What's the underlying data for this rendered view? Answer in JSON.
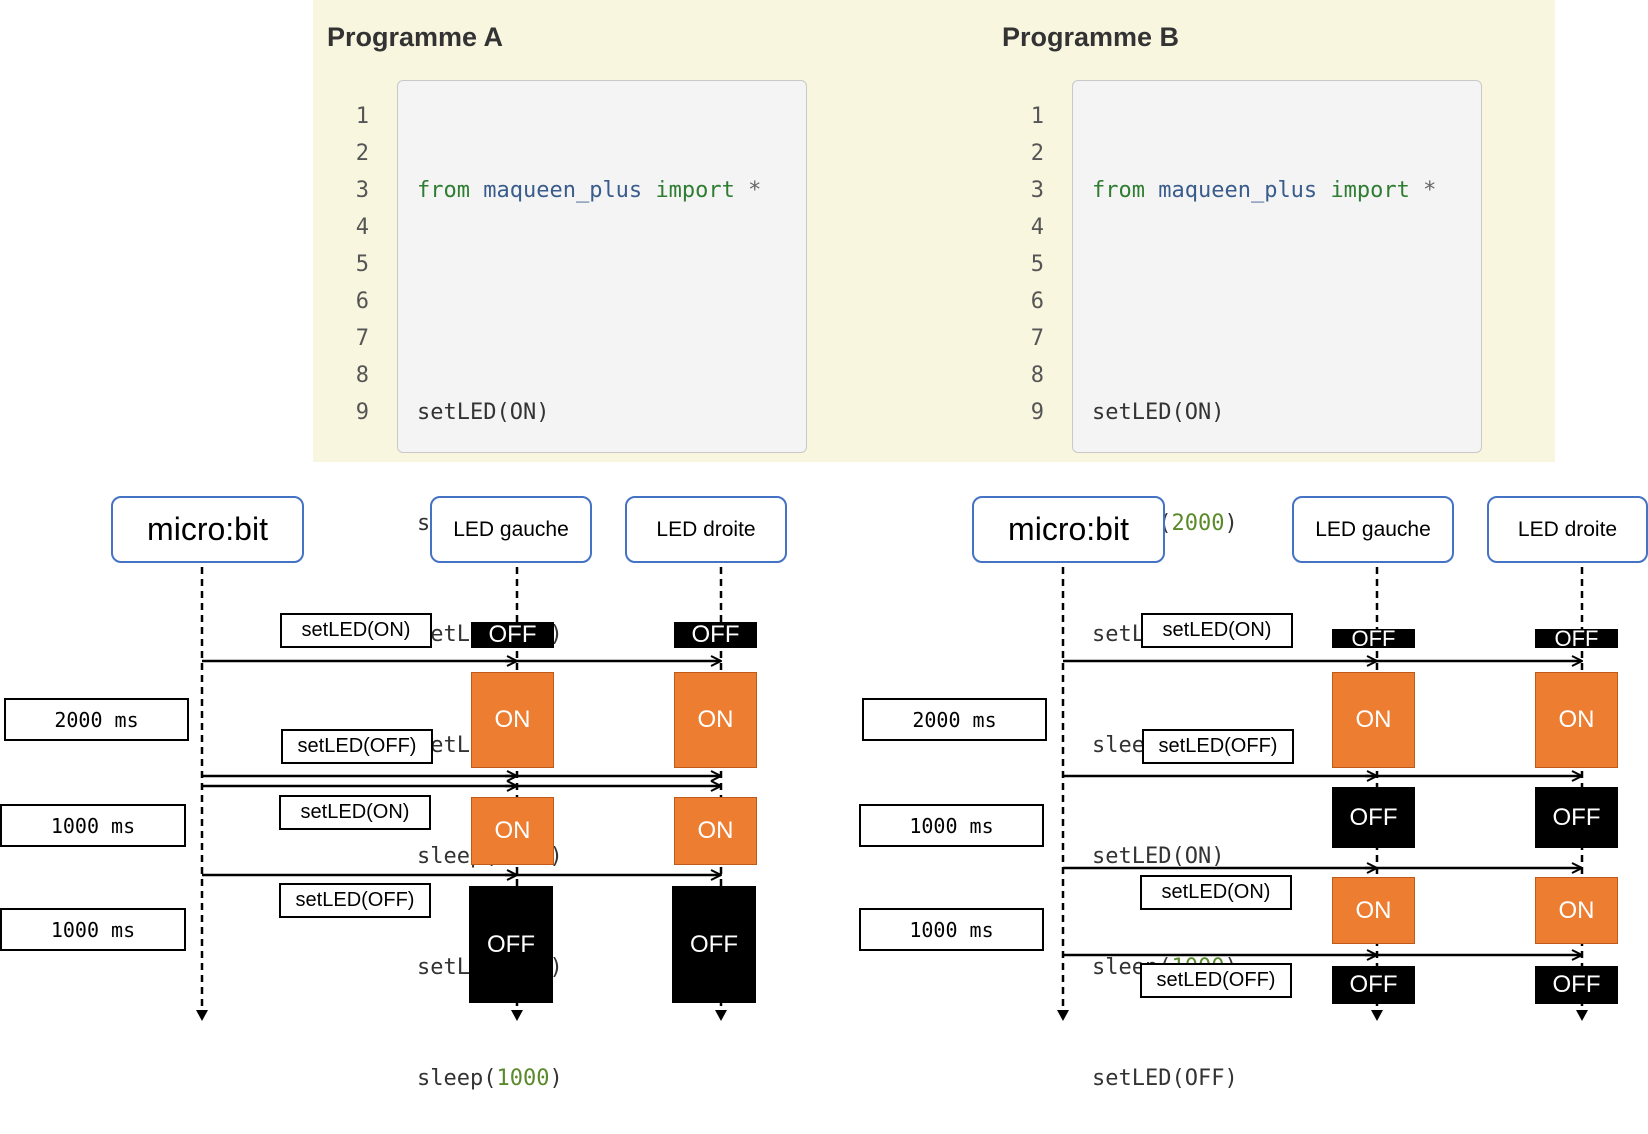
{
  "programs": {
    "a": {
      "title": "Programme A",
      "line_numbers": [
        "1",
        "2",
        "3",
        "4",
        "5",
        "6",
        "7",
        "8",
        "9"
      ]
    },
    "b": {
      "title": "Programme B",
      "line_numbers": [
        "1",
        "2",
        "3",
        "4",
        "5",
        "6",
        "7",
        "8",
        "9"
      ]
    },
    "common": {
      "kw_from": "from",
      "module": "maqueen_plus",
      "kw_import": "import",
      "star": "*",
      "setled_on": "setLED(ON)",
      "setled_off": "setLED(OFF)",
      "sleep_open": "sleep(",
      "sleep_close": ")",
      "n2000": "2000",
      "n1000": "1000"
    }
  },
  "diagrams": {
    "microbit": "micro:bit",
    "led_left": "LED gauche",
    "led_right": "LED droite",
    "msg_on": "setLED(ON)",
    "msg_off": "setLED(OFF)",
    "d2000": "2000 ms",
    "d1000": "1000 ms",
    "on": "ON",
    "off": "OFF"
  },
  "colors": {
    "panel": "#f9f6e0",
    "on_state": "#ed7d31",
    "off_state": "#000000",
    "header_border": "#4472c4"
  }
}
